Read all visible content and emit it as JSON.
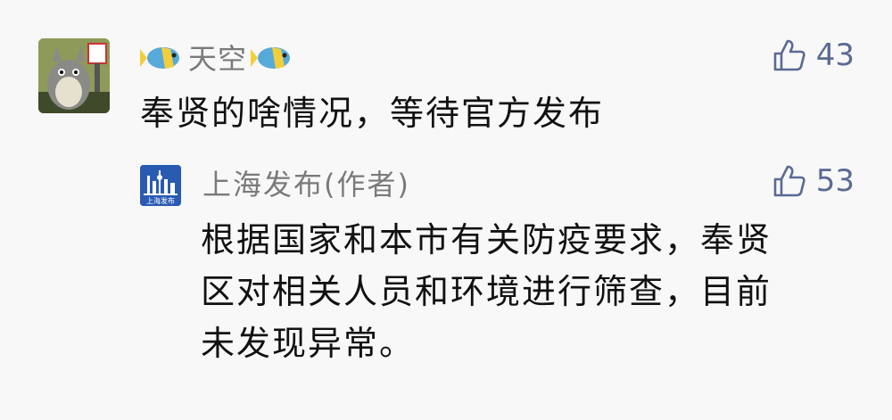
{
  "comment": {
    "author": "天空",
    "text": "奉贤的啥情况，等待官方发布",
    "likes": "43",
    "avatar_icon": "totoro-avatar-icon",
    "decor_icon": "tropical-fish-emoji"
  },
  "reply": {
    "author": "上海发布(作者)",
    "text_lines": [
      "根据国家和本市有关防疫要求，奉贤",
      "区对相关人员和环境进行筛查，目前",
      "未发现异常。"
    ],
    "likes": "53",
    "logo_text": "上海发布",
    "logo_color": "#2a5bb3"
  },
  "like_color": "#5a6a94"
}
